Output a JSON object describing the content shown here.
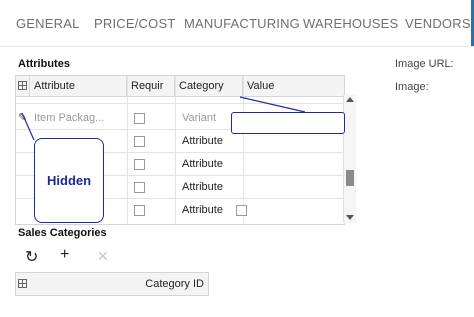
{
  "tabs": [
    "GENERAL",
    "PRICE/COST",
    "MANUFACTURING",
    "WAREHOUSES",
    "VENDORS"
  ],
  "attributes_section": {
    "title": "Attributes",
    "columns": [
      "Attribute",
      "Requir",
      "Category",
      "Value"
    ],
    "rows": [
      {
        "attribute": "Item Packag...",
        "required": false,
        "category": "Variant",
        "value": ""
      },
      {
        "attribute": "",
        "required": false,
        "category": "Attribute",
        "value": ""
      },
      {
        "attribute": "",
        "required": false,
        "category": "Attribute",
        "value": ""
      },
      {
        "attribute": "",
        "required": false,
        "category": "Attribute",
        "value": ""
      },
      {
        "attribute": "",
        "required": false,
        "category": "Attribute",
        "value": ""
      }
    ]
  },
  "annotations": {
    "hidden_label": "Hidden"
  },
  "side_panel": {
    "image_url_label": "Image URL:",
    "image_label": "Image:"
  },
  "sales_categories": {
    "title": "Sales Categories",
    "toolbar": {
      "refresh_icon": "refresh-icon",
      "add_icon": "plus-icon",
      "delete_icon": "close-icon"
    },
    "columns": [
      "Category ID"
    ]
  },
  "colors": {
    "accent": "#1f2aa0",
    "tab_text": "#6f6f6f",
    "scroll_thumb": "#8b8b8b"
  }
}
